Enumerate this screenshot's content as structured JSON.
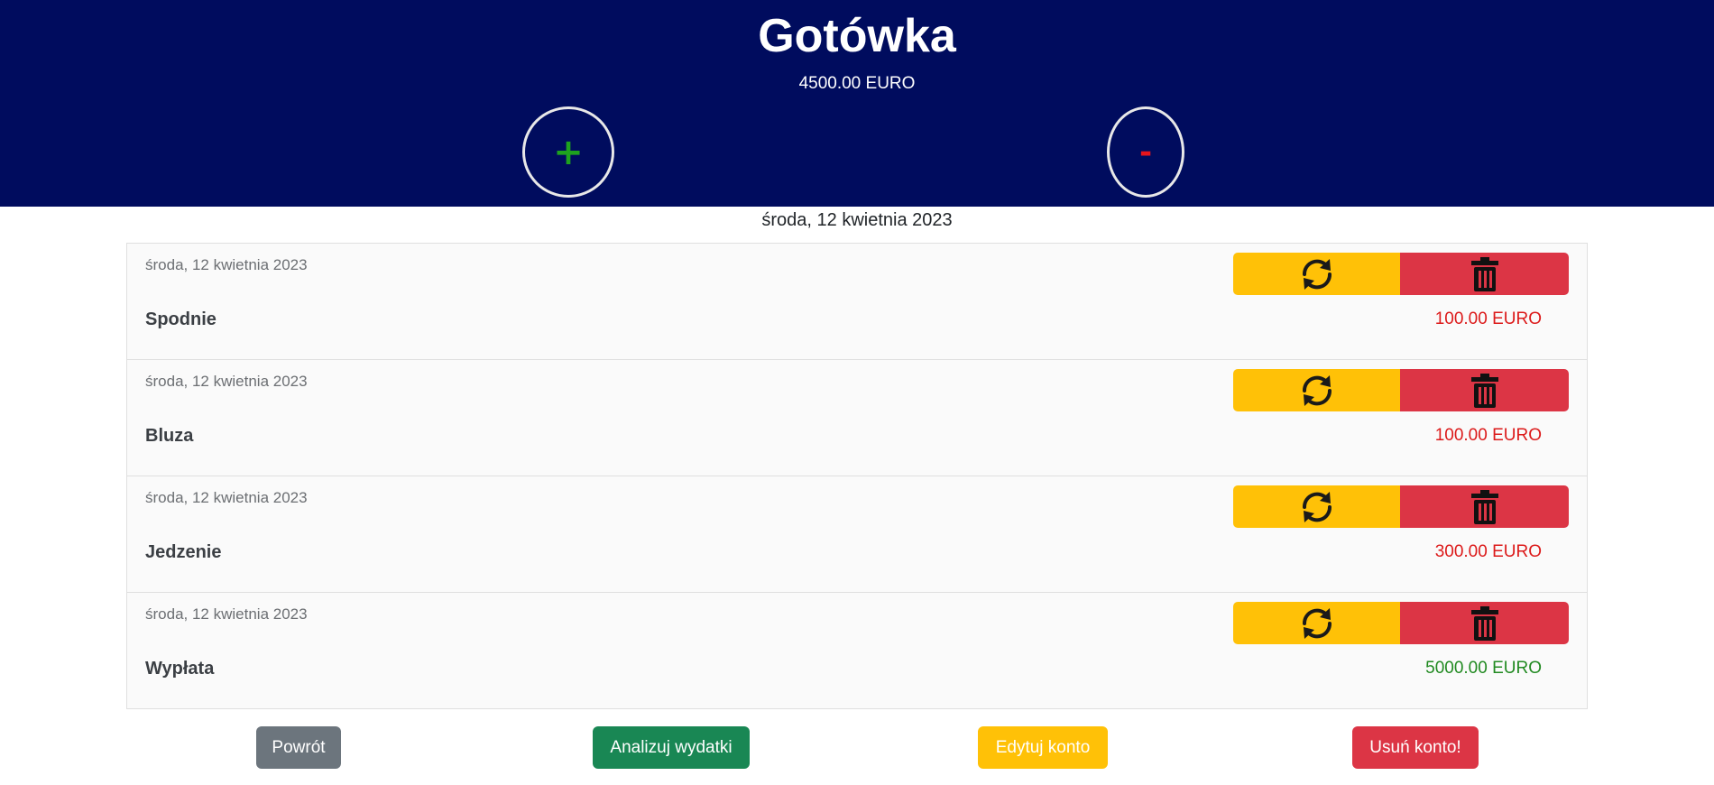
{
  "header": {
    "title": "Gotówka",
    "balance": "4500.00 EURO",
    "add_label": "+",
    "subtract_label": "-"
  },
  "date_heading": "środa, 12 kwietnia 2023",
  "transactions": [
    {
      "date": "środa, 12 kwietnia 2023",
      "name": "Spodnie",
      "amount": "100.00 EURO",
      "type": "expense"
    },
    {
      "date": "środa, 12 kwietnia 2023",
      "name": "Bluza",
      "amount": "100.00 EURO",
      "type": "expense"
    },
    {
      "date": "środa, 12 kwietnia 2023",
      "name": "Jedzenie",
      "amount": "300.00 EURO",
      "type": "expense"
    },
    {
      "date": "środa, 12 kwietnia 2023",
      "name": "Wypłata",
      "amount": "5000.00 EURO",
      "type": "income"
    }
  ],
  "row_actions": {
    "edit_icon": "refresh-icon",
    "delete_icon": "trash-icon"
  },
  "footer": {
    "back_label": "Powrót",
    "analyze_label": "Analizuj wydatki",
    "edit_label": "Edytuj konto",
    "delete_label": "Usuń konto!"
  },
  "colors": {
    "header_bg": "#000c5e",
    "edit": "#ffc107",
    "delete": "#dc3545",
    "expense": "#dc1a1a",
    "income": "#218a21",
    "analyze": "#198754",
    "back": "#6c757d"
  }
}
